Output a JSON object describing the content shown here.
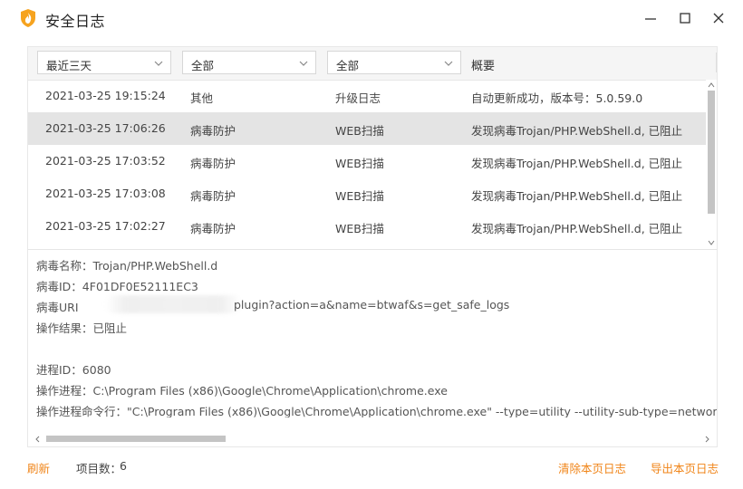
{
  "window": {
    "title": "安全日志"
  },
  "filters": {
    "time_range": "最近三天",
    "category": "全部",
    "type": "全部",
    "summary_header": "概要"
  },
  "log_rows": [
    {
      "time": "2021-03-25 19:15:24",
      "category": "其他",
      "type": "升级日志",
      "summary": "自动更新成功，版本号：5.0.59.0",
      "selected": false
    },
    {
      "time": "2021-03-25 17:06:26",
      "category": "病毒防护",
      "type": "WEB扫描",
      "summary": "发现病毒Trojan/PHP.WebShell.d, 已阻止",
      "selected": true
    },
    {
      "time": "2021-03-25 17:03:52",
      "category": "病毒防护",
      "type": "WEB扫描",
      "summary": "发现病毒Trojan/PHP.WebShell.d, 已阻止",
      "selected": false
    },
    {
      "time": "2021-03-25 17:03:08",
      "category": "病毒防护",
      "type": "WEB扫描",
      "summary": "发现病毒Trojan/PHP.WebShell.d, 已阻止",
      "selected": false
    },
    {
      "time": "2021-03-25 17:02:27",
      "category": "病毒防护",
      "type": "WEB扫描",
      "summary": "发现病毒Trojan/PHP.WebShell.d, 已阻止",
      "selected": false
    }
  ],
  "detail": {
    "virus_name": "病毒名称：Trojan/PHP.WebShell.d",
    "virus_id": "病毒ID：4F01DF0E52111EC3",
    "virus_uri_label": "病毒URI",
    "virus_uri_rest": "plugin?action=a&name=btwaf&s=get_safe_logs",
    "result": "操作结果：已阻止",
    "process_id": "进程ID：6080",
    "process": "操作进程：C:\\Program Files (x86)\\Google\\Chrome\\Application\\chrome.exe",
    "process_cmd": "操作进程命令行：\"C:\\Program Files (x86)\\Google\\Chrome\\Application\\chrome.exe\" --type=utility --utility-sub-type=network.mojom"
  },
  "footer": {
    "refresh": "刷新",
    "count_label": "项目数：",
    "count_value": "6",
    "clear": "清除本页日志",
    "export": "导出本页日志"
  },
  "colors": {
    "accent": "#f08519",
    "selected_row": "#e4e4e4",
    "logo": "#f5a623"
  },
  "icons": [
    "shield-logo-icon",
    "minimize-icon",
    "maximize-icon",
    "close-icon",
    "chevron-down-icon"
  ]
}
